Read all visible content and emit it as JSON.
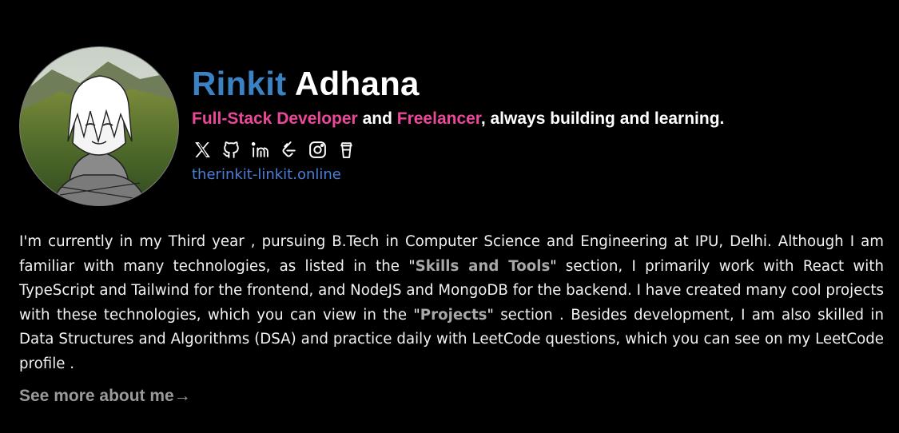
{
  "profile": {
    "first_name": "Rinkit",
    "last_name": "Adhana",
    "avatar_alt": "anime-style-portrait-avatar"
  },
  "tagline": {
    "role1": "Full-Stack Developer",
    "and": " and ",
    "role2": "Freelancer",
    "rest": ", always building and learning."
  },
  "socials": [
    "x-icon",
    "github-icon",
    "linkedin-icon",
    "leetcode-icon",
    "instagram-icon",
    "coffee-icon"
  ],
  "website": "therinkit-linkit.online",
  "bio": {
    "p1": "I'm currently in my Third year , pursuing B.Tech in Computer Science and Engineering at IPU, Delhi. Although I am familiar with many technologies, as listed in the \"",
    "skills": "Skills and Tools",
    "p2": "\" section, I primarily work with React with TypeScript and Tailwind for the frontend, and NodeJS and MongoDB for the backend. I have created many cool projects with these technologies, which you can view in the \"",
    "projects": "Projects",
    "p3": "\" section . Besides development, I am also skilled in Data Structures and Algorithms (DSA) and practice daily with LeetCode questions, which you can see on my LeetCode profile ."
  },
  "see_more": "See more about me",
  "see_more_arrow": "→",
  "colors": {
    "first_name": "#3b82c4",
    "accent_pink": "#ec4899",
    "link_blue": "#4a7fd8",
    "muted": "#9a9a9a"
  }
}
